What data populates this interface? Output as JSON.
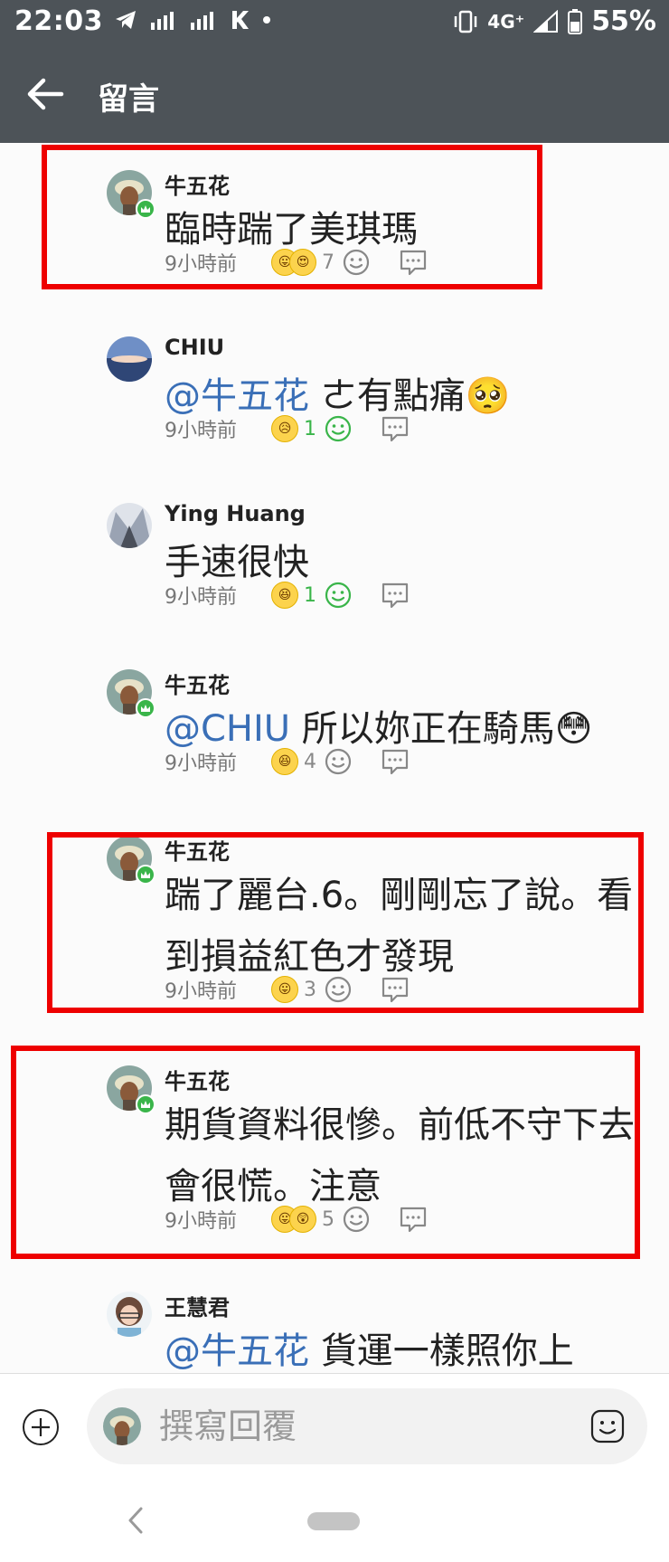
{
  "status_bar": {
    "time": "22:03",
    "network": "4G⁺",
    "battery": "55%"
  },
  "app_bar": {
    "title": "留言"
  },
  "comments": [
    {
      "author": "牛五花",
      "mention": "",
      "text": "臨時踹了美琪瑪",
      "time": "9小時前",
      "reactions": [
        "😛",
        "😍"
      ],
      "count": "7"
    },
    {
      "author": "CHIU",
      "mention": "@牛五花",
      "text": " ㄜ有點痛🥺",
      "time": "9小時前",
      "reactions": [
        "😥"
      ],
      "count": "1"
    },
    {
      "author": "Ying Huang",
      "mention": "",
      "text": "手速很快",
      "time": "9小時前",
      "reactions": [
        "😆"
      ],
      "count": "1"
    },
    {
      "author": "牛五花",
      "mention": "@CHIU",
      "text": " 所以妳正在騎馬😳",
      "time": "9小時前",
      "reactions": [
        "😆"
      ],
      "count": "4"
    },
    {
      "author": "牛五花",
      "mention": "",
      "text": "踹了麗台.6。剛剛忘了說。看到損益紅色才發現",
      "time": "9小時前",
      "reactions": [
        "😛"
      ],
      "count": "3"
    },
    {
      "author": "牛五花",
      "mention": "",
      "text": "期貨資料很慘。前低不守下去會很慌。注意",
      "time": "9小時前",
      "reactions": [
        "😛",
        "😲"
      ],
      "count": "5"
    },
    {
      "author": "王慧君",
      "mention": "@牛五花",
      "text": " 貨運一樣照你上",
      "time": "",
      "reactions": [],
      "count": ""
    }
  ],
  "reply": {
    "placeholder": "撰寫回覆"
  },
  "colors": {
    "bar": "#4d5358",
    "mention": "#3a6fb7",
    "highlight": "#ee0000",
    "badge": "#3ab54a"
  }
}
